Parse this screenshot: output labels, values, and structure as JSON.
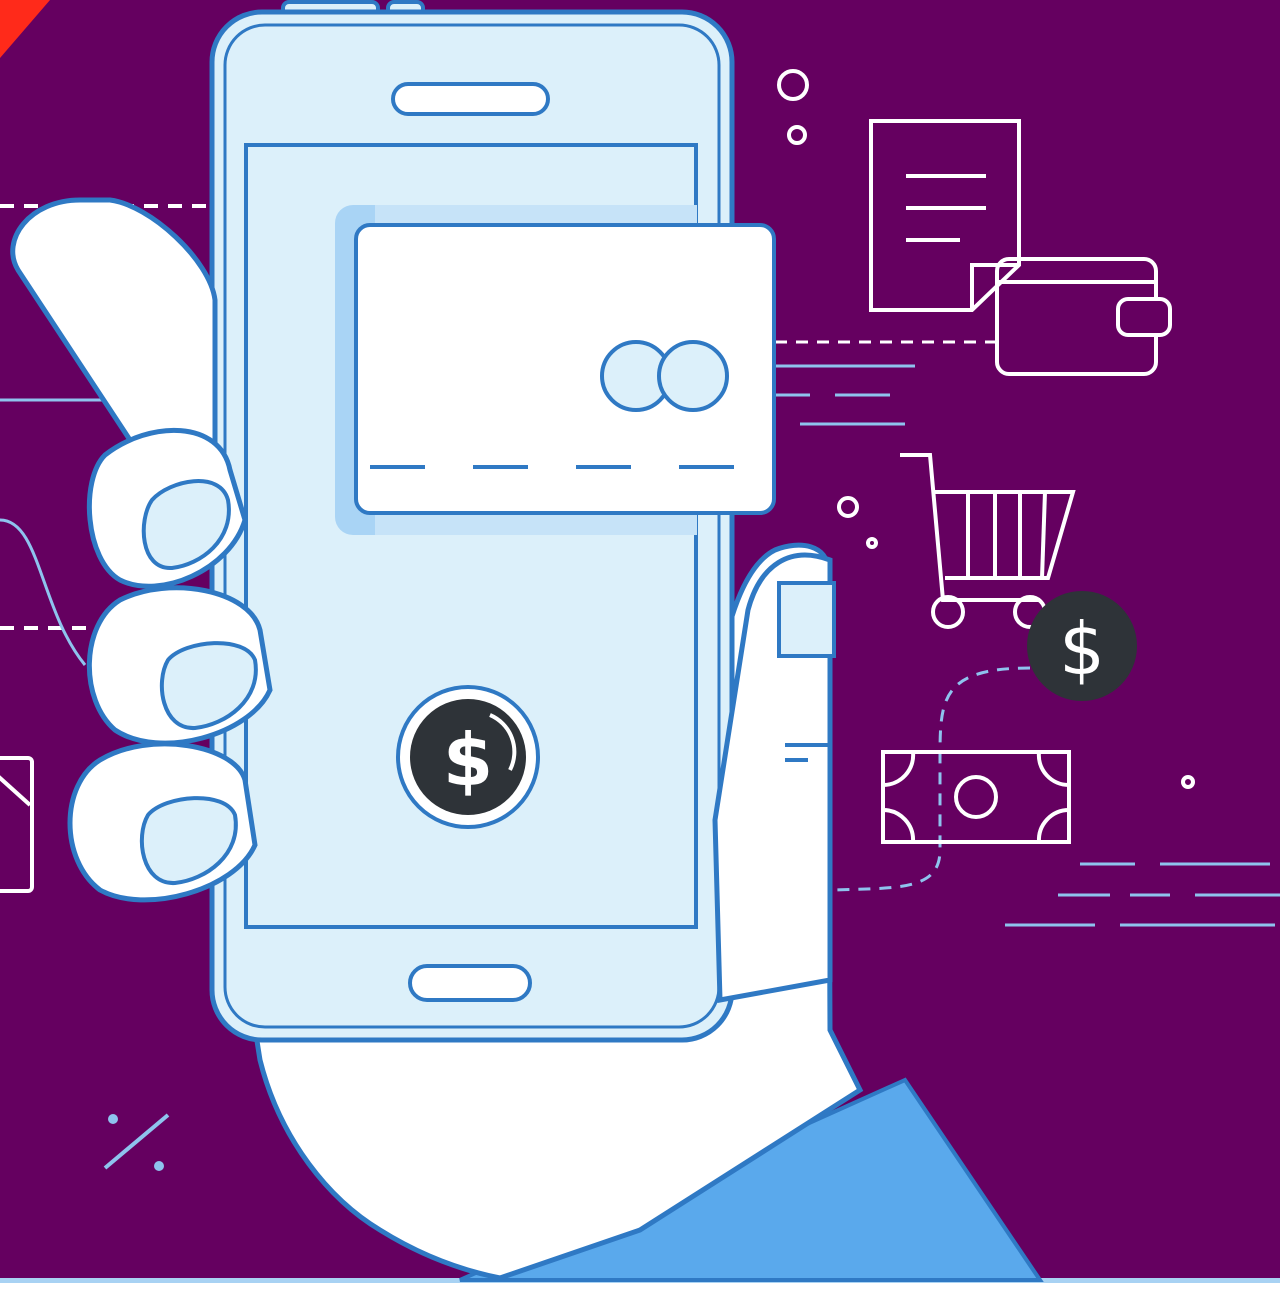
{
  "illustration": {
    "subject": "mobile-payment",
    "colors": {
      "background": "#650060",
      "phone_fill": "#dcf0fa",
      "outline": "#2f79c4",
      "hand_fill": "#ffffff",
      "sleeve": "#5aa9ec",
      "accent_dark": "#2e3338",
      "line_light": "#8ec3ee",
      "corner_ribbon": "#ff2a1a"
    }
  },
  "phone_pay_button": {
    "symbol": "$"
  },
  "dollar_coin": {
    "symbol": "$"
  },
  "discount_sign": {
    "symbol": "%"
  }
}
